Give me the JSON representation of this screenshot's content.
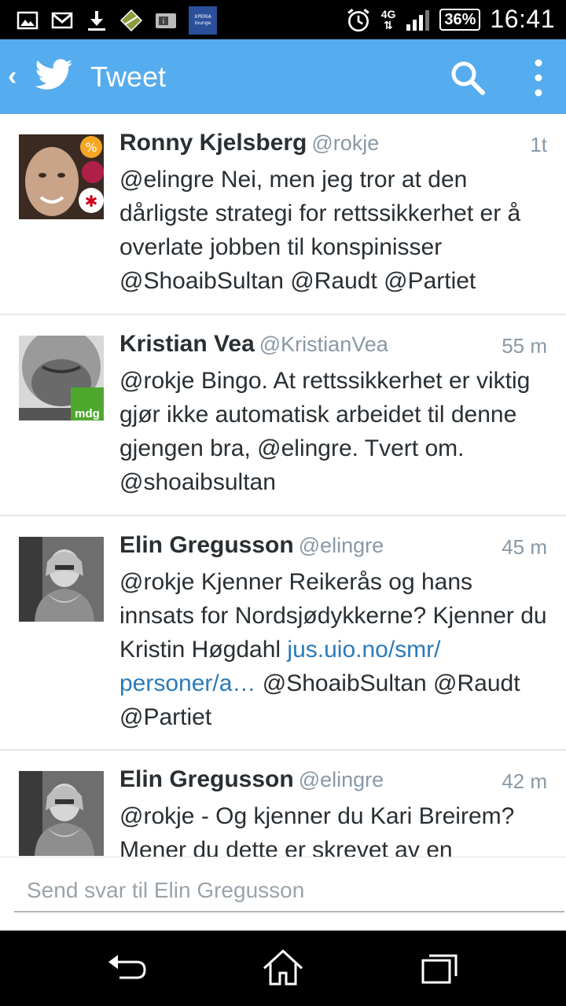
{
  "status_bar": {
    "left_icons": [
      "image-icon",
      "gmail-icon",
      "download-icon",
      "app-icon",
      "id-card-icon",
      "xperia-lounge-icon"
    ],
    "xperia_label": "XPERIA lounge",
    "network": "4G",
    "battery": "36%",
    "time": "16:41"
  },
  "app_bar": {
    "title": "Tweet",
    "accent": "#55acee"
  },
  "tweets": [
    {
      "name": "Ronny Kjelsberg",
      "handle": "@rokje",
      "time": "1t",
      "text": "@elingre Nei, men jeg tror at den dårligste strategi for rettssikkerhet er å overlate jobben til konspinisser @ShoaibSultan @Raudt @Partiet"
    },
    {
      "name": "Kristian Vea",
      "handle": "@KristianVea",
      "time": "55 m",
      "text": "@rokje Bingo. At rettssikkerhet er viktig gjør ikke automatisk arbeidet til denne gjengen bra, @elingre. Tvert om. @shoaibsultan",
      "avatar_badge": "mdg"
    },
    {
      "name": "Elin Gregusson",
      "handle": "@elingre",
      "time": "45 m",
      "text_before": "@rokje Kjenner Reikerås og hans innsats for Nordsjødykkerne? Kjenner du Kristin Høgdahl ",
      "link": "jus.uio.no/smr/ personer/a…",
      "text_after": " @ShoaibSultan @Raudt @Partiet"
    },
    {
      "name": "Elin Gregusson",
      "handle": "@elingre",
      "time": "42 m",
      "text": "@rokje - Og kjenner du Kari Breirem? Mener du dette er skrevet av en"
    }
  ],
  "reply": {
    "placeholder": "Send svar til Elin Gregusson"
  }
}
